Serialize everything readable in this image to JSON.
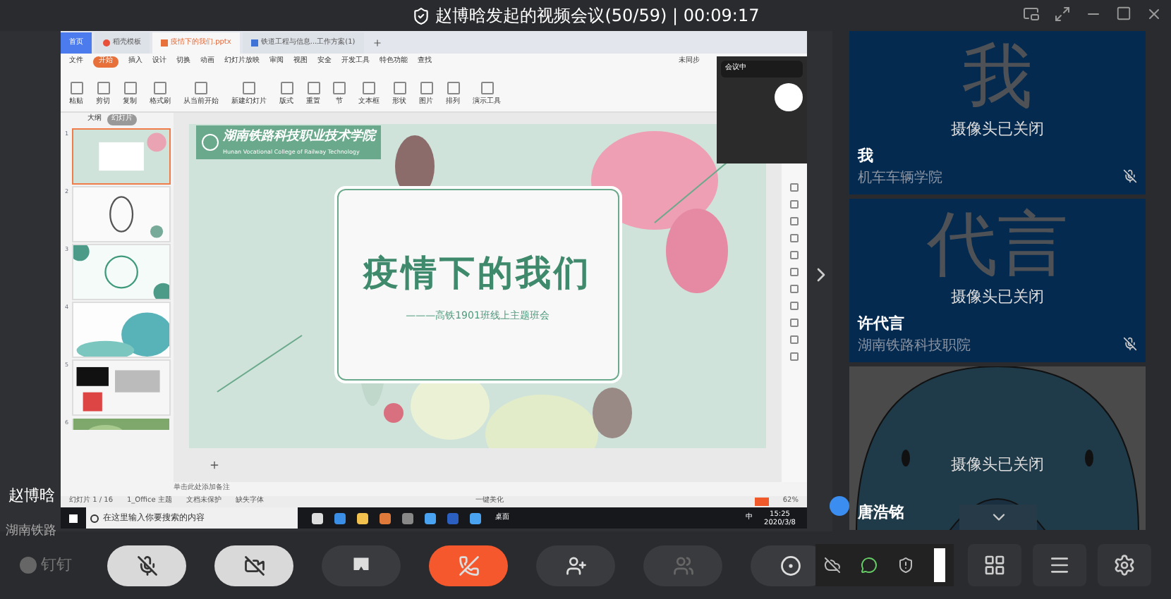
{
  "meeting": {
    "title": "赵博晗发起的视频会议(50/59) | 00:09:17"
  },
  "presenter": {
    "name": "赵博晗",
    "org": "湖南铁路"
  },
  "shared_screen": {
    "tabs": [
      {
        "label": "首页",
        "kind": "home",
        "selected": false
      },
      {
        "label": "稻壳模板",
        "kind": "docer",
        "selected": false
      },
      {
        "label": "疫情下的我们.pptx",
        "kind": "ppt",
        "selected": true
      },
      {
        "label": "铁道工程与信息...工作方案(1)",
        "kind": "word",
        "selected": false
      }
    ],
    "menu": [
      {
        "label": "文件",
        "selected": false
      },
      {
        "label": "开始",
        "selected": true
      },
      {
        "label": "插入",
        "selected": false
      },
      {
        "label": "设计",
        "selected": false
      },
      {
        "label": "切换",
        "selected": false
      },
      {
        "label": "动画",
        "selected": false
      },
      {
        "label": "幻灯片放映",
        "selected": false
      },
      {
        "label": "审阅",
        "selected": false
      },
      {
        "label": "视图",
        "selected": false
      },
      {
        "label": "安全",
        "selected": false
      },
      {
        "label": "开发工具",
        "selected": false
      },
      {
        "label": "特色功能",
        "selected": false
      },
      {
        "label": "查找",
        "selected": false
      }
    ],
    "sync_label": "未同步",
    "ribbon": [
      "粘贴",
      "剪切",
      "复制",
      "格式刷",
      "从当前开始",
      "新建幻灯片",
      "版式",
      "重置",
      "节",
      "文本框",
      "形状",
      "图片",
      "排列",
      "演示工具"
    ],
    "panel_tabs": [
      {
        "label": "大纲",
        "selected": false
      },
      {
        "label": "幻灯片",
        "selected": true
      }
    ],
    "thumbnails": [
      {
        "number": "1",
        "selected": true
      },
      {
        "number": "2",
        "selected": false
      },
      {
        "number": "3",
        "selected": false
      },
      {
        "number": "4",
        "selected": false
      },
      {
        "number": "5",
        "selected": false
      },
      {
        "number": "6",
        "selected": false
      }
    ],
    "slide": {
      "college_name": "湖南铁路科技职业技术学院",
      "college_english": "Hunan Vocational College of Railway Technology",
      "title": "疫情下的我们",
      "subtitle": "———高铁1901班线上主题班会"
    },
    "notes_placeholder": "单击此处添加备注",
    "status": [
      "幻灯片 1 / 16",
      "1_Office 主题",
      "文档未保护",
      "缺失字体"
    ],
    "beautify": "一键美化",
    "zoom": "62%",
    "floating_window": {
      "label": "会议中"
    },
    "taskbar": {
      "search_placeholder": "在这里输入你要搜索的内容",
      "desktop": "桌面",
      "ime": "中",
      "time": "15:25",
      "date": "2020/3/8"
    }
  },
  "participants": [
    {
      "kind": "initials",
      "watermark": "我",
      "camera_status": "摄像头已关闭",
      "name": "我",
      "org": "机车车辆学院",
      "muted": true
    },
    {
      "kind": "initials",
      "watermark": "代言",
      "camera_status": "摄像头已关闭",
      "name": "许代言",
      "org": "湖南铁路科技职院",
      "muted": true
    },
    {
      "kind": "avatar",
      "camera_status": "摄像头已关闭",
      "name": "唐浩铭",
      "muted": false
    }
  ],
  "toolbar": {
    "logo": "钉钉",
    "buttons": [
      {
        "kind": "mic",
        "off": true,
        "disabled": false
      },
      {
        "kind": "camera",
        "off": true,
        "disabled": false
      },
      {
        "kind": "share",
        "off": false,
        "disabled": false
      },
      {
        "kind": "hangup",
        "off": false,
        "disabled": false
      },
      {
        "kind": "add",
        "off": false,
        "disabled": false
      },
      {
        "kind": "mute_all",
        "off": false,
        "disabled": true
      },
      {
        "kind": "record",
        "off": false,
        "disabled": false
      }
    ],
    "right_buttons": [
      {
        "kind": "grid"
      },
      {
        "kind": "list"
      },
      {
        "kind": "settings"
      }
    ]
  }
}
